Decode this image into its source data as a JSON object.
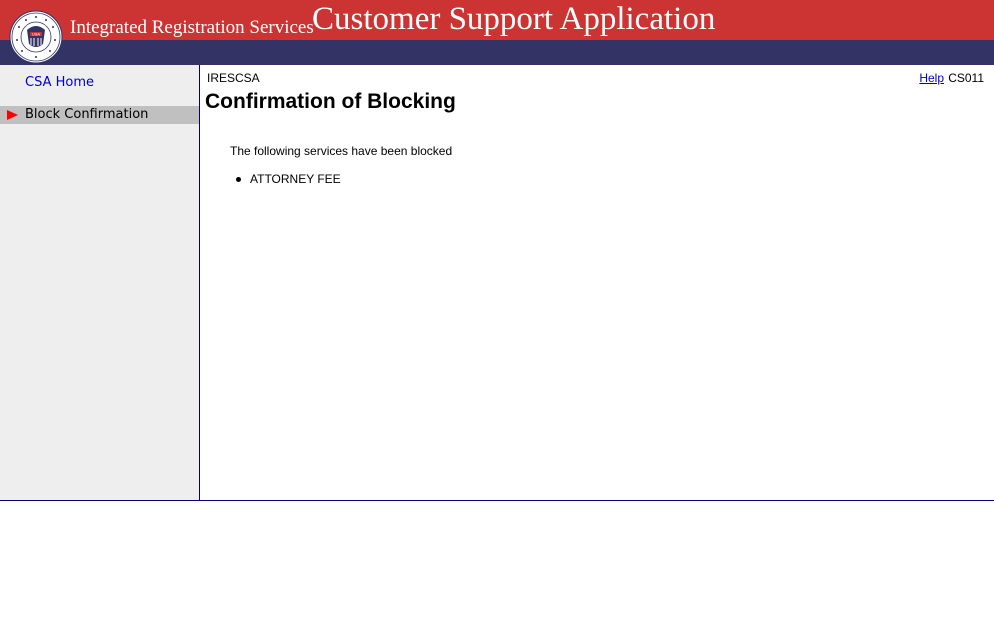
{
  "header": {
    "org_name": "Integrated Registration Services",
    "app_title": "Customer Support Application",
    "seal_icon": "ssa-seal-icon",
    "colors": {
      "top_band": "#cc3333",
      "bottom_band": "#333366"
    }
  },
  "sidebar": {
    "home_label": "CSA Home",
    "active_label": "Block Confirmation",
    "active_marker_color": "#ff0000"
  },
  "content": {
    "system_id": "IRESCSA",
    "help_label": "Help",
    "screen_code": "CS011",
    "title": "Confirmation of Blocking",
    "message": "The following services have been blocked",
    "services": [
      "ATTORNEY FEE"
    ]
  }
}
